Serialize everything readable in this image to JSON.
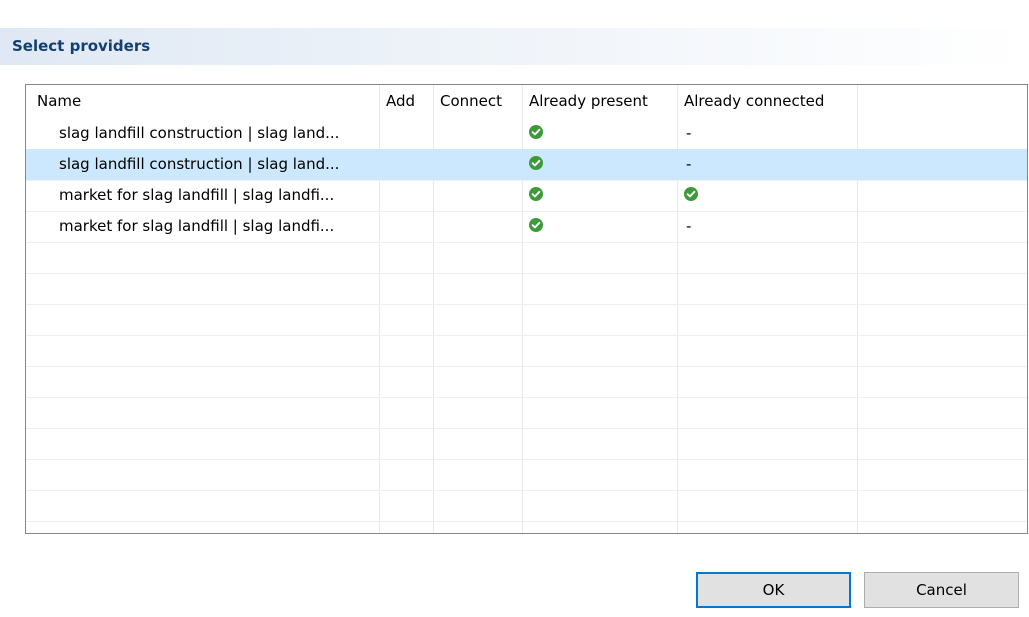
{
  "dialog": {
    "title": "Select providers"
  },
  "table": {
    "columns": [
      "Name",
      "Add",
      "Connect",
      "Already present",
      "Already connected"
    ],
    "rows": [
      {
        "name": "slag landfill construction | slag land...",
        "add": "",
        "connect": "",
        "already_present": "check",
        "already_connected": "-",
        "selected": false
      },
      {
        "name": "slag landfill construction | slag land...",
        "add": "",
        "connect": "",
        "already_present": "check",
        "already_connected": "-",
        "selected": true
      },
      {
        "name": "market for slag landfill | slag landfi...",
        "add": "",
        "connect": "",
        "already_present": "check",
        "already_connected": "check",
        "selected": false
      },
      {
        "name": "market for slag landfill | slag landfi...",
        "add": "",
        "connect": "",
        "already_present": "check",
        "already_connected": "-",
        "selected": false
      }
    ]
  },
  "buttons": {
    "ok": "OK",
    "cancel": "Cancel"
  },
  "colors": {
    "title_text": "#143f72",
    "selection": "#cce8ff",
    "check_icon": "#3c9a3a",
    "default_button_border": "#0078d7"
  }
}
